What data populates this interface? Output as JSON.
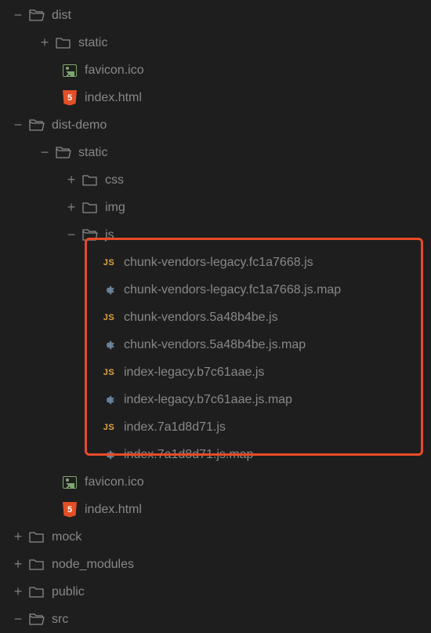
{
  "tree": [
    {
      "id": "dist",
      "expander": "−",
      "depth": 0,
      "iconType": "folder-open",
      "label": "dist"
    },
    {
      "id": "dist-static",
      "expander": "+",
      "depth": 1,
      "iconType": "folder",
      "label": "static"
    },
    {
      "id": "dist-favicon",
      "expander": "",
      "depth": 2,
      "iconType": "image",
      "label": "favicon.ico"
    },
    {
      "id": "dist-index",
      "expander": "",
      "depth": 2,
      "iconType": "html5",
      "label": "index.html"
    },
    {
      "id": "dist-demo",
      "expander": "−",
      "depth": 0,
      "iconType": "folder-open",
      "label": "dist-demo"
    },
    {
      "id": "dist-demo-static",
      "expander": "−",
      "depth": 1,
      "iconType": "folder-open",
      "label": "static"
    },
    {
      "id": "dist-demo-css",
      "expander": "+",
      "depth": 2,
      "iconType": "folder",
      "label": "css"
    },
    {
      "id": "dist-demo-img",
      "expander": "+",
      "depth": 2,
      "iconType": "folder",
      "label": "img"
    },
    {
      "id": "dist-demo-js",
      "expander": "−",
      "depth": 2,
      "iconType": "folder-open",
      "label": "js"
    },
    {
      "id": "f1",
      "expander": "",
      "depth": 3,
      "iconType": "js",
      "label": "chunk-vendors-legacy.fc1a7668.js",
      "inBox": true
    },
    {
      "id": "f2",
      "expander": "",
      "depth": 3,
      "iconType": "gear",
      "label": "chunk-vendors-legacy.fc1a7668.js.map",
      "inBox": true
    },
    {
      "id": "f3",
      "expander": "",
      "depth": 3,
      "iconType": "js",
      "label": "chunk-vendors.5a48b4be.js",
      "inBox": true
    },
    {
      "id": "f4",
      "expander": "",
      "depth": 3,
      "iconType": "gear",
      "label": "chunk-vendors.5a48b4be.js.map",
      "inBox": true
    },
    {
      "id": "f5",
      "expander": "",
      "depth": 3,
      "iconType": "js",
      "label": "index-legacy.b7c61aae.js",
      "inBox": true
    },
    {
      "id": "f6",
      "expander": "",
      "depth": 3,
      "iconType": "gear",
      "label": "index-legacy.b7c61aae.js.map",
      "inBox": true
    },
    {
      "id": "f7",
      "expander": "",
      "depth": 3,
      "iconType": "js",
      "label": "index.7a1d8d71.js",
      "inBox": true
    },
    {
      "id": "f8",
      "expander": "",
      "depth": 3,
      "iconType": "gear",
      "label": "index.7a1d8d71.js.map",
      "inBox": true
    },
    {
      "id": "dist-demo-favicon",
      "expander": "",
      "depth": 2,
      "iconType": "image",
      "label": "favicon.ico"
    },
    {
      "id": "dist-demo-index",
      "expander": "",
      "depth": 2,
      "iconType": "html5",
      "label": "index.html"
    },
    {
      "id": "mock",
      "expander": "+",
      "depth": 0,
      "iconType": "folder",
      "label": "mock"
    },
    {
      "id": "node_modules",
      "expander": "+",
      "depth": 0,
      "iconType": "folder",
      "label": "node_modules"
    },
    {
      "id": "public",
      "expander": "+",
      "depth": 0,
      "iconType": "folder",
      "label": "public"
    },
    {
      "id": "src",
      "expander": "−",
      "depth": 0,
      "iconType": "folder-open",
      "label": "src"
    }
  ],
  "colors": {
    "highlight": "#e84a27",
    "background": "#1e1e1e"
  }
}
